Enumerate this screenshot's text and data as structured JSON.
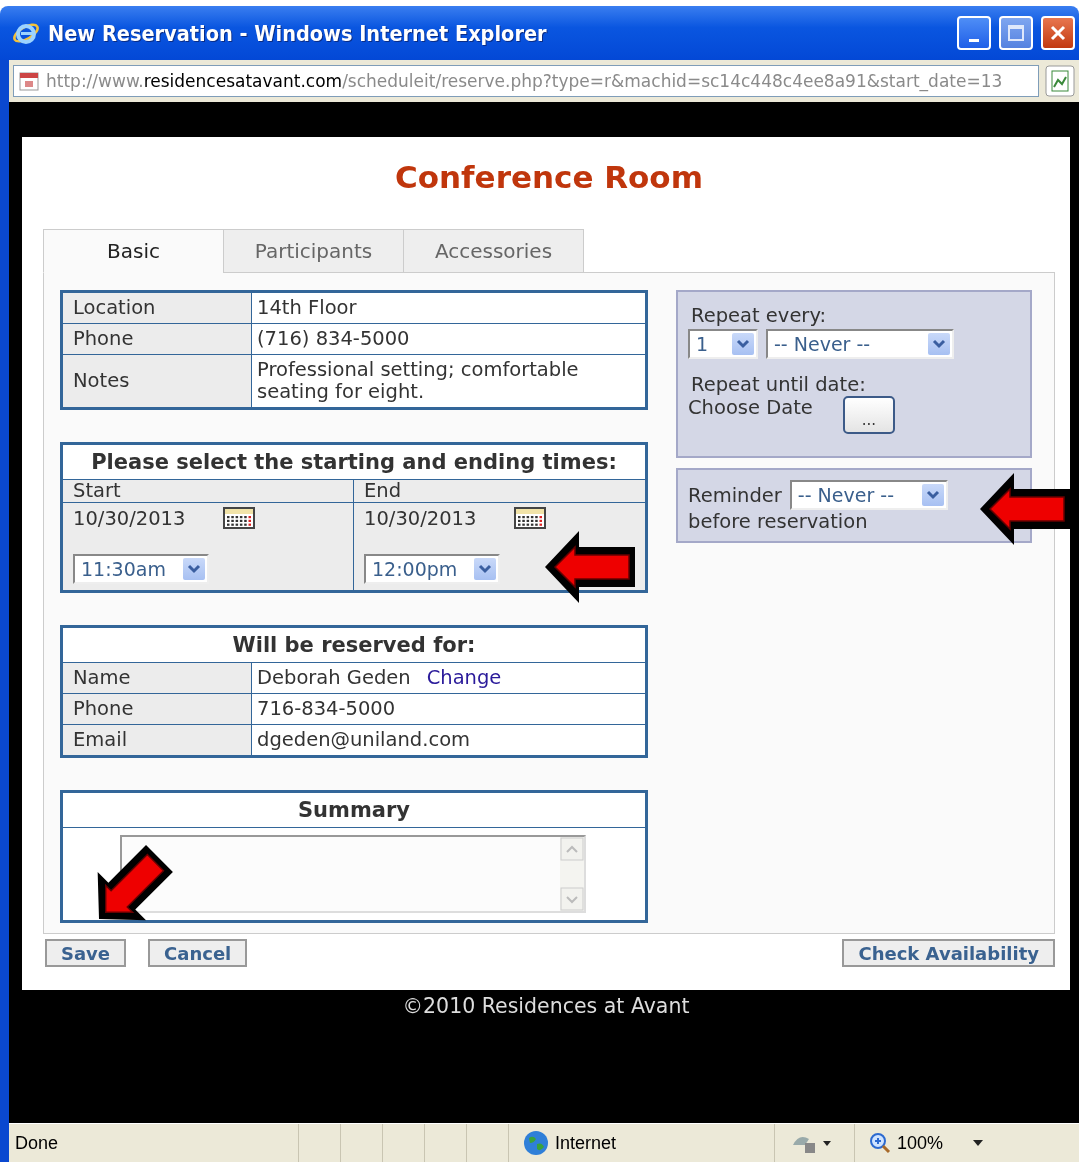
{
  "window": {
    "title": "New Reservation - Windows Internet Explorer"
  },
  "address_bar": {
    "prefix": "http://www.",
    "domain": "residencesatavant.com",
    "path": "/scheduleit/reserve.php?type=r&machid=sc14c448c4ee8a91&start_date=13"
  },
  "heading": "Conference Room",
  "tabs": [
    {
      "label": "Basic",
      "selected": true
    },
    {
      "label": "Participants",
      "selected": false
    },
    {
      "label": "Accessories",
      "selected": false
    }
  ],
  "resource_details": [
    {
      "label": "Location",
      "value": "14th Floor"
    },
    {
      "label": "Phone",
      "value": "(716) 834-5000"
    },
    {
      "label": "Notes",
      "value": "Professional setting; comfortable seating for eight."
    }
  ],
  "times": {
    "title": "Please select the starting and ending times:",
    "columns": [
      {
        "label": "Start",
        "date": "10/30/2013",
        "time": "11:30am"
      },
      {
        "label": "End",
        "date": "10/30/2013",
        "time": "12:00pm"
      }
    ]
  },
  "reserved_for": {
    "title": "Will be reserved for:",
    "rows": [
      {
        "label": "Name",
        "value": "Deborah Geden",
        "link": "Change"
      },
      {
        "label": "Phone",
        "value": "716-834-5000"
      },
      {
        "label": "Email",
        "value": "dgeden@uniland.com"
      }
    ]
  },
  "summary": {
    "title": "Summary"
  },
  "repeat": {
    "label": "Repeat every:",
    "interval": "1",
    "frequency": "-- Never --",
    "until_label": "Repeat until date:",
    "date_label": "Choose Date",
    "date_button": "..."
  },
  "reminder": {
    "label": "Reminder",
    "value": "-- Never --",
    "suffix": "before reservation"
  },
  "buttons": [
    {
      "label": "Save"
    },
    {
      "label": "Cancel"
    }
  ],
  "check_button": "Check Availability",
  "footer": "©2010 Residences at Avant",
  "status_bar": {
    "text": "Done",
    "zone": "Internet",
    "zoom": "100%"
  }
}
